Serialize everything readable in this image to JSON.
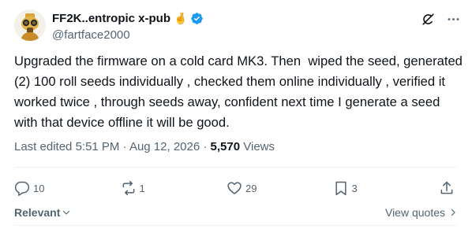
{
  "author": {
    "display_name": "FF2K..entropic x-pub",
    "name_emoji": "🤞",
    "handle": "@fartface2000"
  },
  "tweet": {
    "text": "Upgraded the firmware on a cold card MK3. Then  wiped the seed, generated (2) 100 roll seeds individually , checked them online individually , verified it worked twice , through seeds away, confident next time I generate a seed with that device offline it will be good."
  },
  "meta": {
    "last_edited": "Last edited",
    "time": "5:51 PM",
    "separator": "·",
    "date": "Aug 12, 2026",
    "views_count": "5,570",
    "views_label": "Views"
  },
  "actions": {
    "replies": "10",
    "reposts": "1",
    "likes": "29",
    "bookmarks": "3"
  },
  "footer": {
    "sort_label": "Relevant",
    "view_quotes_label": "View quotes"
  },
  "colors": {
    "primary_text": "#0f1419",
    "secondary_text": "#536471",
    "verified_blue": "#1d9bf0",
    "divider": "#eff3f4"
  }
}
